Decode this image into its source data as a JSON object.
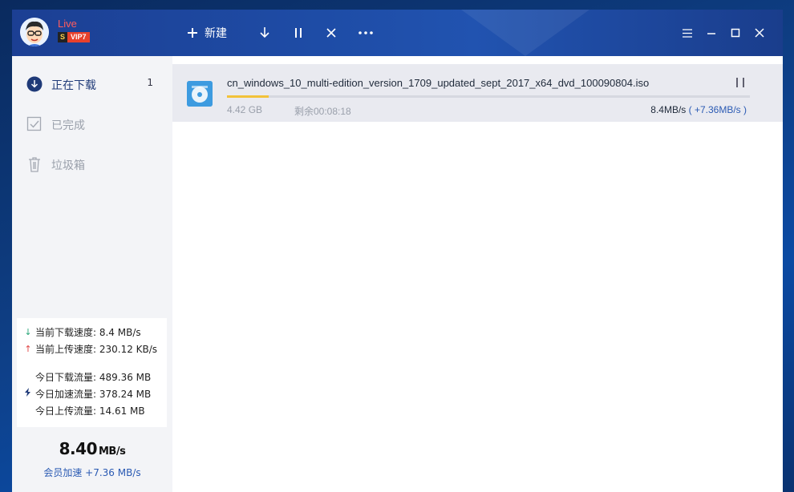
{
  "app": {
    "live_label": "Live",
    "vip_s": "S",
    "vip_label": "VIP7"
  },
  "toolbar": {
    "new_label": "新建",
    "icons": [
      "plus-icon",
      "download-icon",
      "pause-icon",
      "close-icon",
      "more-icon"
    ]
  },
  "window_controls": [
    "menu-icon",
    "minimize-icon",
    "maximize-icon",
    "close-icon"
  ],
  "sidebar": {
    "items": [
      {
        "label": "正在下载",
        "count": "1",
        "icon": "download-circle-icon"
      },
      {
        "label": "已完成",
        "icon": "checkbox-icon"
      },
      {
        "label": "垃圾箱",
        "icon": "trash-icon"
      }
    ]
  },
  "stats": {
    "down_speed": "当前下载速度: 8.4 MB/s",
    "up_speed": "当前上传速度: 230.12 KB/s",
    "today_down": "今日下载流量: 489.36 MB",
    "today_accel": "今日加速流量: 378.24 MB",
    "today_up": "今日上传流量: 14.61 MB"
  },
  "speed_summary": {
    "value": "8.40",
    "unit": "MB/s",
    "member_label": "会员加速 +7.36 MB/s"
  },
  "tasks": [
    {
      "filename": "cn_windows_10_multi-edition_version_1709_updated_sept_2017_x64_dvd_100090804.iso",
      "size": "4.42 GB",
      "remaining": "剩余00:08:18",
      "speed": "8.4MB/s",
      "accel": "( +7.36MB/s )",
      "progress": 0.08
    }
  ],
  "colors": {
    "titlebar": "#1e4ca6",
    "accent": "#2a5ab3",
    "progress": "#f2c23a",
    "sidebar": "#f3f4f7"
  }
}
